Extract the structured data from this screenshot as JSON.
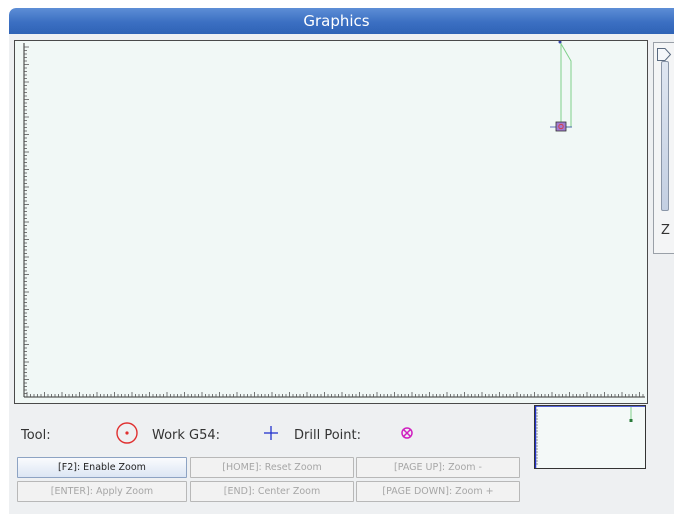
{
  "window": {
    "title": "Graphics"
  },
  "legend": {
    "tool_label": "Tool:",
    "work_label": "Work G54:",
    "drill_label": "Drill Point:"
  },
  "z_axis": {
    "label": "Z"
  },
  "buttons": [
    {
      "label": "[F2]: Enable Zoom",
      "enabled": true
    },
    {
      "label": "[HOME]: Reset Zoom",
      "enabled": false
    },
    {
      "label": "[PAGE UP]: Zoom -",
      "enabled": false
    },
    {
      "label": "[ENTER]: Apply Zoom",
      "enabled": false
    },
    {
      "label": "[END]: Center Zoom",
      "enabled": false
    },
    {
      "label": "[PAGE DOWN]: Zoom +",
      "enabled": false
    }
  ],
  "colors": {
    "tool_marker": "#e03030",
    "work_marker": "#2233cc",
    "drill_marker": "#d020c0",
    "toolpath": "#7fd08a"
  },
  "icons": {
    "tool": "circle-dot-icon",
    "work": "plus-icon",
    "drill": "circle-x-icon",
    "slider": "slider-thumb-icon"
  }
}
